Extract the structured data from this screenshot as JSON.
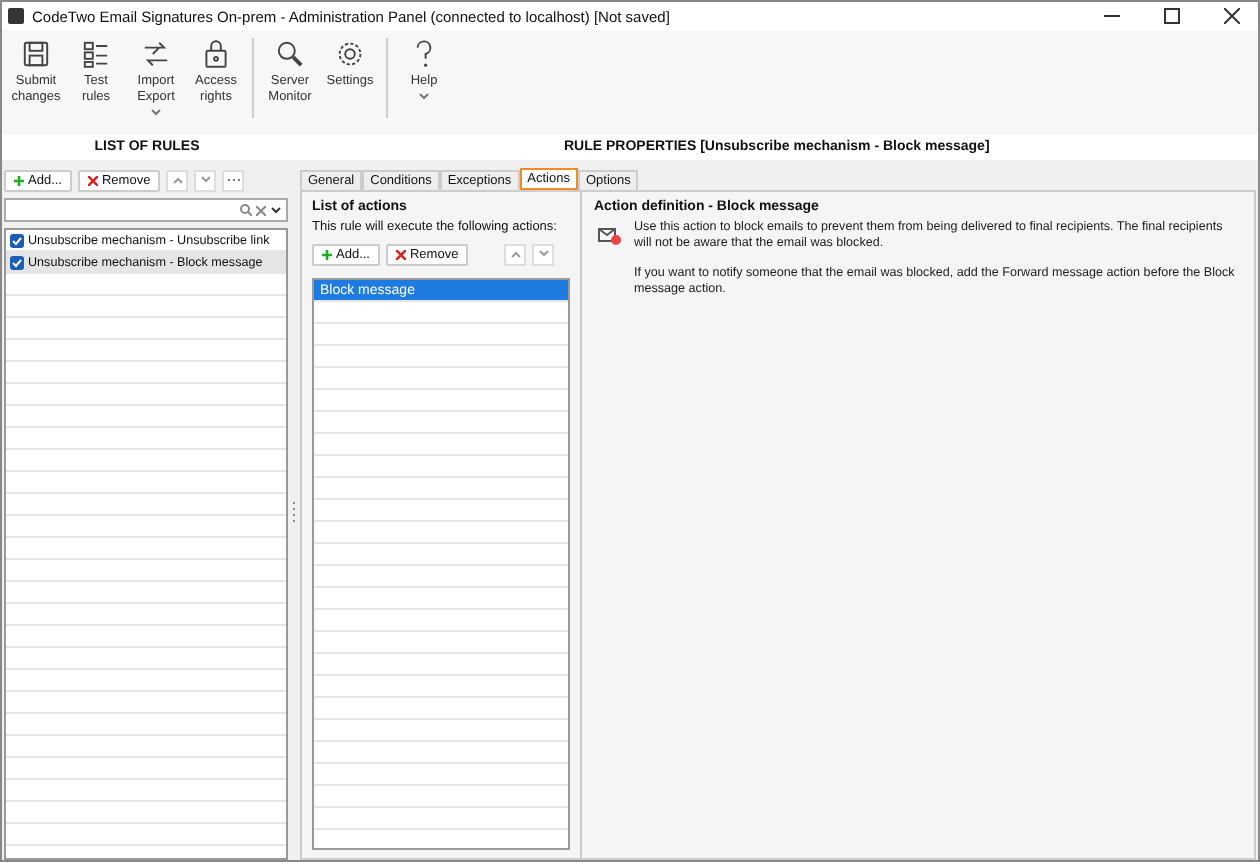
{
  "window": {
    "title": "CodeTwo Email Signatures On-prem - Administration Panel (connected to localhost) [Not saved]"
  },
  "toolbar": [
    {
      "items": [
        {
          "kind": "save",
          "label": "Submit changes",
          "caret": false
        },
        {
          "kind": "checklist",
          "label": "Test rules",
          "caret": false
        },
        {
          "kind": "swap",
          "label": "Import Export",
          "caret": true
        },
        {
          "kind": "lock",
          "label": "Access rights",
          "caret": false
        }
      ]
    },
    {
      "items": [
        {
          "kind": "search",
          "label": "Server Monitor",
          "caret": false
        },
        {
          "kind": "gear",
          "label": "Settings",
          "caret": false
        }
      ]
    },
    {
      "items": [
        {
          "kind": "help",
          "label": "Help",
          "caret": true
        }
      ]
    }
  ],
  "rules_panel": {
    "title": "LIST OF RULES",
    "add": "Add...",
    "remove": "Remove",
    "rules": [
      {
        "label": "Unsubscribe mechanism - Unsubscribe link",
        "checked": true,
        "selected": false
      },
      {
        "label": "Unsubscribe mechanism - Block message",
        "checked": true,
        "selected": true
      }
    ]
  },
  "properties": {
    "title": "RULE PROPERTIES [Unsubscribe mechanism - Block message]",
    "tabs": [
      {
        "label": "General",
        "selected": false
      },
      {
        "label": "Conditions",
        "selected": false
      },
      {
        "label": "Exceptions",
        "selected": false
      },
      {
        "label": "Actions",
        "selected": true
      },
      {
        "label": "Options",
        "selected": false
      }
    ],
    "actions": {
      "title": "List of actions",
      "hint": "This rule will execute the following actions:",
      "add": "Add...",
      "remove": "Remove",
      "items": [
        {
          "label": "Block message",
          "selected": true
        }
      ]
    },
    "definition": {
      "title": "Action definition - Block message",
      "paragraphs": [
        "Use this action to block emails to prevent them from being delivered to final recipients. The final recipients will not be aware that the email was blocked.",
        "If you want to notify someone that the email was blocked, add the Forward message action before the Block message action."
      ]
    }
  }
}
